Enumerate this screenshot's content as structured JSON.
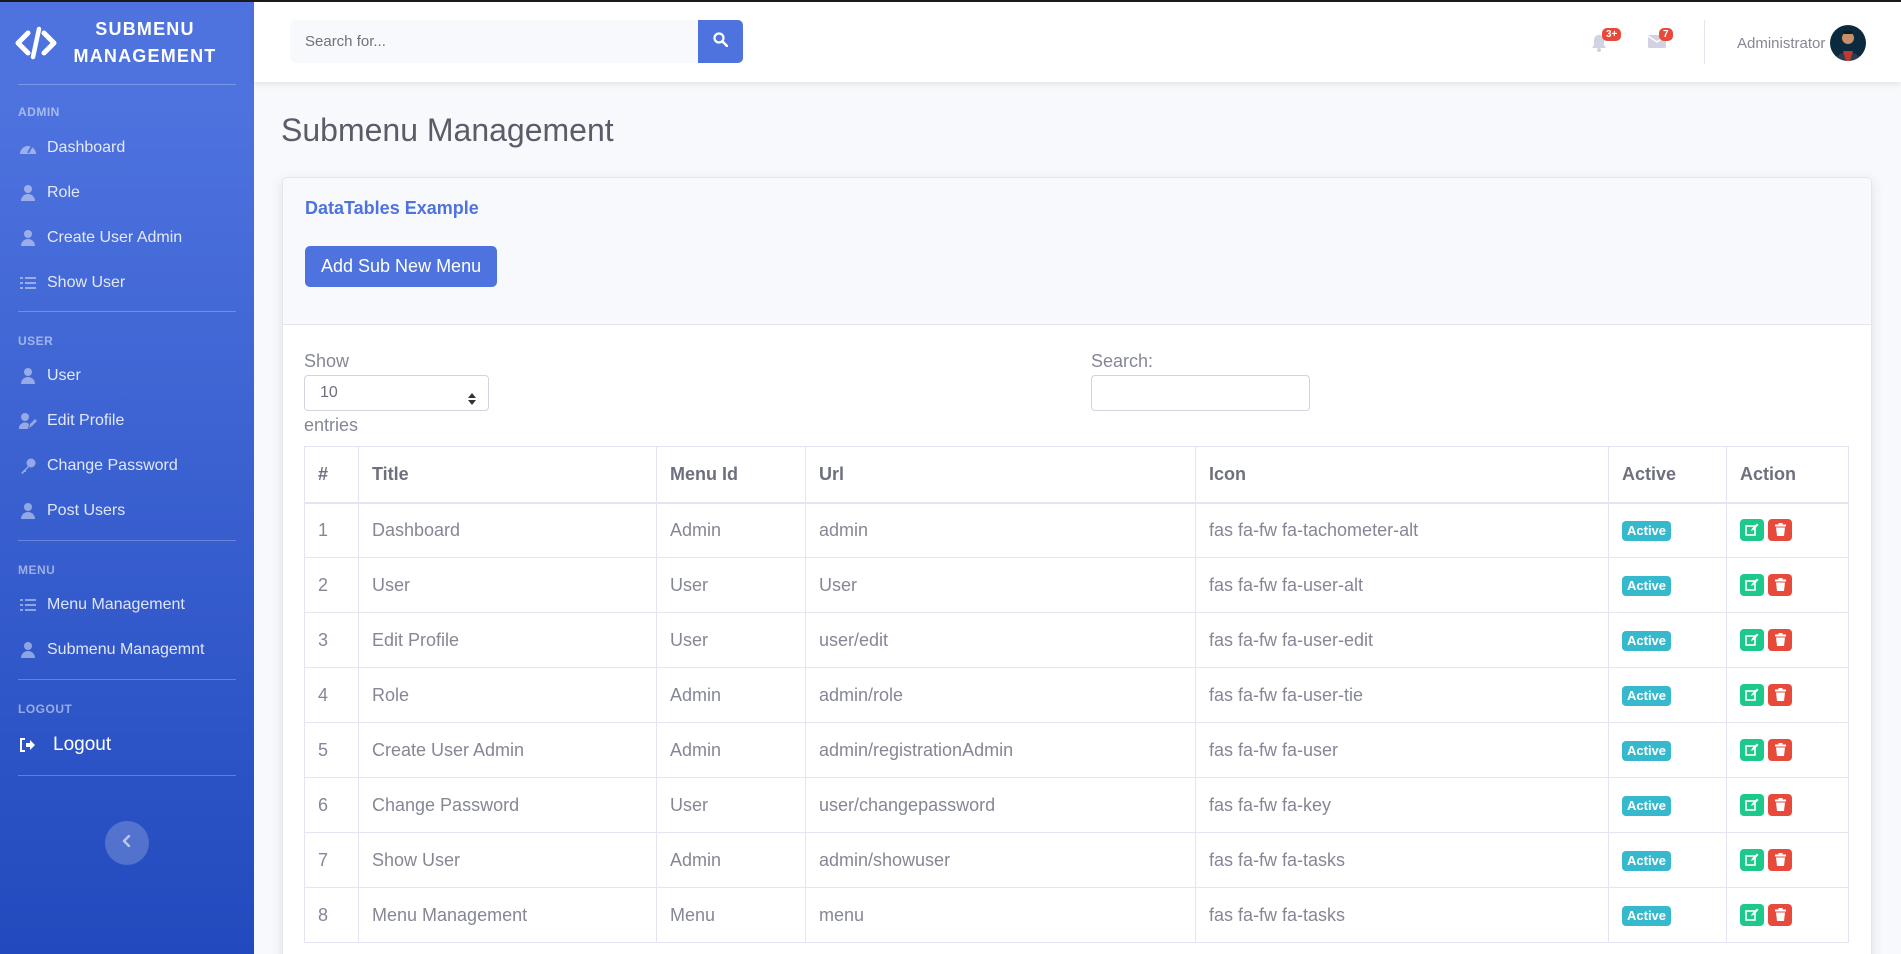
{
  "brand": {
    "line1": "SUBMENU",
    "line2": "MANAGEMENT"
  },
  "sidebar": {
    "sections": [
      {
        "heading": "ADMIN",
        "items": [
          {
            "label": "Dashboard",
            "icon": "tachometer-icon"
          },
          {
            "label": "Role",
            "icon": "user-icon"
          },
          {
            "label": "Create User Admin",
            "icon": "user-icon"
          },
          {
            "label": "Show User",
            "icon": "tasks-icon"
          }
        ]
      },
      {
        "heading": "USER",
        "items": [
          {
            "label": "User",
            "icon": "user-icon"
          },
          {
            "label": "Edit Profile",
            "icon": "user-edit-icon"
          },
          {
            "label": "Change Password",
            "icon": "key-icon"
          },
          {
            "label": "Post Users",
            "icon": "user-icon"
          }
        ]
      },
      {
        "heading": "MENU",
        "items": [
          {
            "label": "Menu Management",
            "icon": "tasks-icon"
          },
          {
            "label": "Submenu Managemnt",
            "icon": "user-icon"
          }
        ]
      },
      {
        "heading": "LOGOUT",
        "items": [
          {
            "label": "Logout",
            "icon": "sign-out-icon"
          }
        ]
      }
    ]
  },
  "topbar": {
    "search_placeholder": "Search for...",
    "alerts_count": "3+",
    "messages_count": "7",
    "user_name": "Administrator"
  },
  "page": {
    "title": "Submenu Management"
  },
  "card": {
    "title": "DataTables Example",
    "add_button": "Add Sub New Menu",
    "show_label": "Show",
    "page_length": "10",
    "entries_label": "entries",
    "search_label": "Search:"
  },
  "table": {
    "headers": [
      "#",
      "Title",
      "Menu Id",
      "Url",
      "Icon",
      "Active",
      "Action"
    ],
    "rows": [
      {
        "n": "1",
        "title": "Dashboard",
        "menu": "Admin",
        "url": "admin",
        "icon": "fas fa-fw fa-tachometer-alt",
        "active": "Active"
      },
      {
        "n": "2",
        "title": "User",
        "menu": "User",
        "url": "User",
        "icon": "fas fa-fw fa-user-alt",
        "active": "Active"
      },
      {
        "n": "3",
        "title": "Edit Profile",
        "menu": "User",
        "url": "user/edit",
        "icon": "fas fa-fw fa-user-edit",
        "active": "Active"
      },
      {
        "n": "4",
        "title": "Role",
        "menu": "Admin",
        "url": "admin/role",
        "icon": "fas fa-fw fa-user-tie",
        "active": "Active"
      },
      {
        "n": "5",
        "title": "Create User Admin",
        "menu": "Admin",
        "url": "admin/registrationAdmin",
        "icon": "fas fa-fw fa-user",
        "active": "Active"
      },
      {
        "n": "6",
        "title": "Change Password",
        "menu": "User",
        "url": "user/changepassword",
        "icon": "fas fa-fw fa-key",
        "active": "Active"
      },
      {
        "n": "7",
        "title": "Show User",
        "menu": "Admin",
        "url": "admin/showuser",
        "icon": "fas fa-fw fa-tasks",
        "active": "Active"
      },
      {
        "n": "8",
        "title": "Menu Management",
        "menu": "Menu",
        "url": "menu",
        "icon": "fas fa-fw fa-tasks",
        "active": "Active"
      }
    ]
  },
  "colors": {
    "primary": "#4e73df",
    "info": "#36b9cc",
    "success": "#1cc88a",
    "danger": "#e74a3b"
  }
}
